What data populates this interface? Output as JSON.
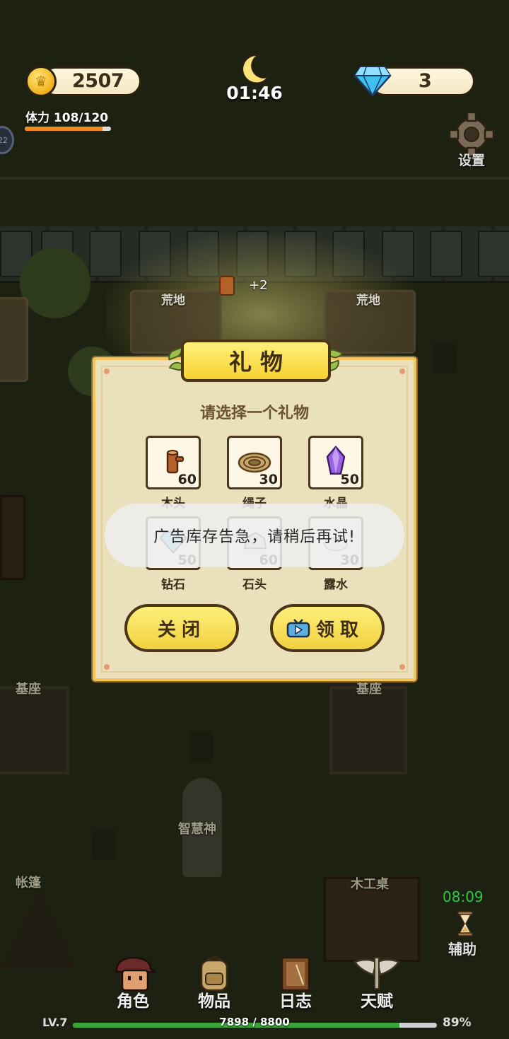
{
  "hud": {
    "gold": "2507",
    "clock": "01:46",
    "gems": "3",
    "stamina_label": "体力 108/120",
    "stamina_fraction": 0.9,
    "round_badge": "22",
    "settings_label": "设置"
  },
  "map": {
    "plot_left_label": "荒地",
    "plot_right_label": "荒地",
    "pedestal_left_label": "基座",
    "pedestal_right_label": "基座",
    "statue_label": "智慧神",
    "tent_label": "帐篷",
    "workbench_label": "木工桌",
    "float_gain": "+2"
  },
  "dialog": {
    "title": "礼物",
    "prompt": "请选择一个礼物",
    "items": [
      {
        "name": "木头",
        "count": "60",
        "icon": "wood-log-icon"
      },
      {
        "name": "绳子",
        "count": "30",
        "icon": "rope-coil-icon"
      },
      {
        "name": "水晶",
        "count": "50",
        "icon": "crystal-icon"
      },
      {
        "name": "钻石",
        "count": "50",
        "icon": "diamond-icon"
      },
      {
        "name": "石头",
        "count": "60",
        "icon": "stone-icon"
      },
      {
        "name": "露水",
        "count": "30",
        "icon": "dew-icon"
      }
    ],
    "close_label": "关闭",
    "claim_label": "领取"
  },
  "toast": "广告库存告急，请稍后再试!",
  "helper": {
    "timer": "08:09",
    "label": "辅助"
  },
  "nav": {
    "items": [
      {
        "label": "角色",
        "icon": "character-icon"
      },
      {
        "label": "物品",
        "icon": "backpack-icon"
      },
      {
        "label": "日志",
        "icon": "journal-icon"
      },
      {
        "label": "天赋",
        "icon": "wings-icon"
      }
    ]
  },
  "level": {
    "label": "LV.7",
    "xp": "7898 / 8800",
    "percent": "89%",
    "fraction": 0.8975
  },
  "colors": {
    "dialog_bg": "#ebe0bc",
    "button_yellow": "#f1d040",
    "xp_green": "#3aa63a",
    "stamina_orange": "#f08a1f",
    "timer_green": "#2ec84a"
  }
}
